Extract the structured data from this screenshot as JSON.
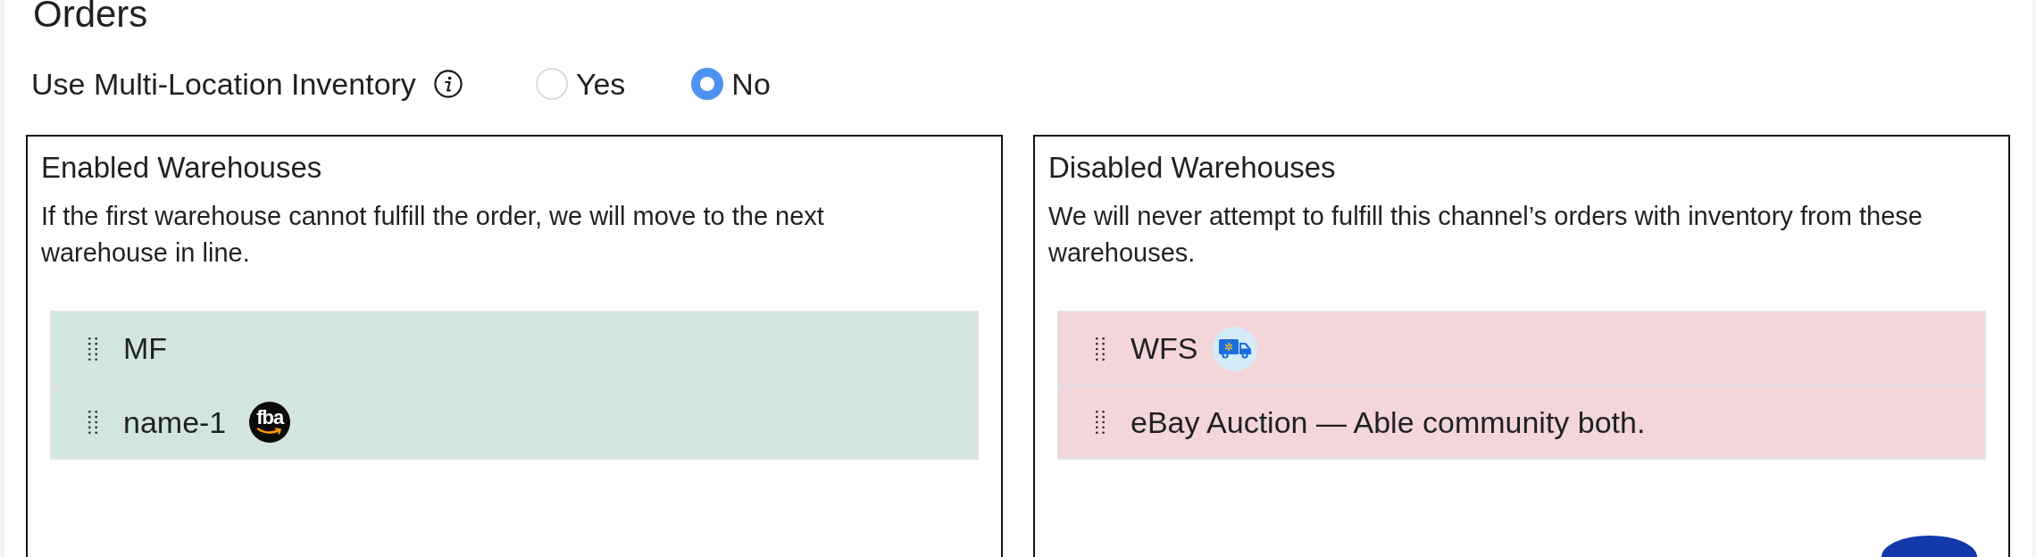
{
  "page": {
    "title": "Orders"
  },
  "multi_location": {
    "label": "Use Multi-Location Inventory",
    "options": [
      {
        "label": "Yes",
        "selected": false
      },
      {
        "label": "No",
        "selected": true
      }
    ]
  },
  "panels": [
    {
      "kind": "enabled",
      "title": "Enabled Warehouses",
      "description": "If the first warehouse cannot fulfill the order, we will move to the next warehouse in line.",
      "warehouses": [
        {
          "label": "MF"
        },
        {
          "label": "name-1",
          "logo": {
            "kind": "fba",
            "text": "fba"
          }
        }
      ]
    },
    {
      "kind": "disabled",
      "title": "Disabled Warehouses",
      "description": "We will never attempt to fulfill this channel’s orders with inventory from these warehouses.",
      "warehouses": [
        {
          "label": "WFS",
          "logo": {
            "kind": "truck"
          }
        },
        {
          "label": "eBay Auction — Able community both."
        }
      ]
    }
  ]
}
